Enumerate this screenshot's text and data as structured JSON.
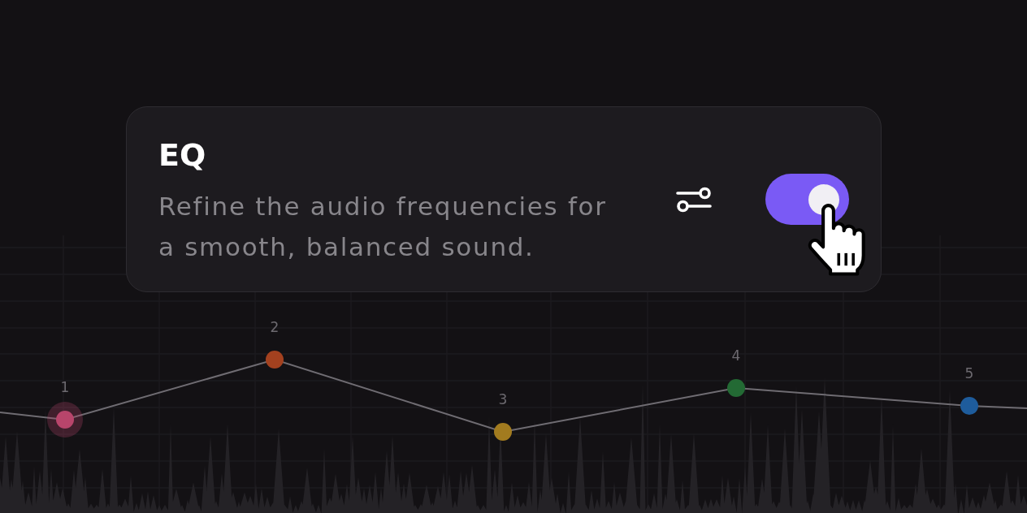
{
  "card": {
    "title": "EQ",
    "description": "Refine the audio frequencies for a smooth, balanced sound.",
    "toggle": {
      "on": true
    }
  },
  "graph": {
    "nodes": [
      {
        "label": "1",
        "color": "#b8456b",
        "selected": true
      },
      {
        "label": "2",
        "color": "#a3411f",
        "selected": false
      },
      {
        "label": "3",
        "color": "#a27b1f",
        "selected": false
      },
      {
        "label": "4",
        "color": "#236a34",
        "selected": false
      },
      {
        "label": "5",
        "color": "#1e5c9c",
        "selected": false
      }
    ]
  }
}
